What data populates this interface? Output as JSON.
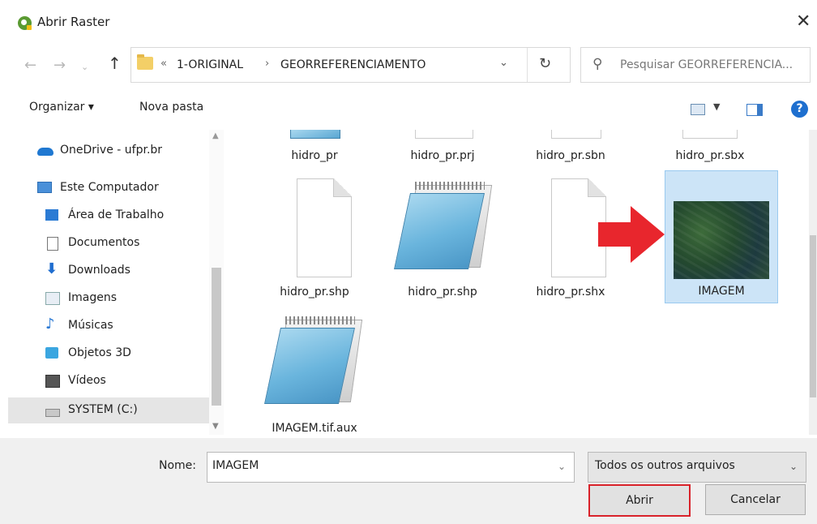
{
  "window": {
    "title": "Abrir Raster",
    "close_glyph": "✕"
  },
  "nav": {
    "back_icon": "←",
    "forward_icon": "→",
    "up_icon": "↑",
    "breadcrumb_prefix": "«",
    "breadcrumb": [
      "1-ORIGINAL",
      "GEORREFERENCIAMENTO"
    ],
    "breadcrumb_sep": "›",
    "dropdown_glyph": "⌄",
    "refresh_glyph": "↻",
    "search_placeholder": "Pesquisar GEORREFERENCIA...",
    "search_glyph": "⚲"
  },
  "toolbar": {
    "organize": "Organizar ▾",
    "new_folder": "Nova pasta",
    "help_glyph": "?"
  },
  "sidebar": {
    "items": [
      {
        "label": "OneDrive - ufpr.br",
        "icon": "onedrive-icon"
      },
      {
        "label": "Este Computador",
        "icon": "computer-icon"
      },
      {
        "label": "Área de Trabalho",
        "icon": "desktop-icon"
      },
      {
        "label": "Documentos",
        "icon": "documents-icon"
      },
      {
        "label": "Downloads",
        "icon": "downloads-icon"
      },
      {
        "label": "Imagens",
        "icon": "pictures-icon"
      },
      {
        "label": "Músicas",
        "icon": "music-icon"
      },
      {
        "label": "Objetos 3D",
        "icon": "objects-3d-icon"
      },
      {
        "label": "Vídeos",
        "icon": "videos-icon"
      },
      {
        "label": "SYSTEM (C:)",
        "icon": "drive-icon"
      }
    ],
    "selected_index": 9
  },
  "files": [
    {
      "name": "hidro_pr",
      "icon": "notepad-icon"
    },
    {
      "name": "hidro_pr.prj",
      "icon": "blank-document-icon"
    },
    {
      "name": "hidro_pr.sbn",
      "icon": "blank-document-icon"
    },
    {
      "name": "hidro_pr.sbx",
      "icon": "blank-document-icon"
    },
    {
      "name": "hidro_pr.shp",
      "icon": "blank-document-icon"
    },
    {
      "name": "hidro_pr.shp",
      "icon": "notepad-icon"
    },
    {
      "name": "hidro_pr.shx",
      "icon": "blank-document-icon"
    },
    {
      "name": "IMAGEM",
      "icon": "raster-image-thumbnail",
      "selected": true
    },
    {
      "name": "IMAGEM.tif.aux",
      "icon": "notepad-icon"
    }
  ],
  "footer": {
    "name_label": "Nome:",
    "name_value": "IMAGEM",
    "type_value": "Todos os outros arquivos",
    "open_button": "Abrir",
    "cancel_button": "Cancelar",
    "dropdown_glyph": "⌄"
  },
  "colors": {
    "highlight_arrow": "#e8262d",
    "selection": "#cce4f7",
    "open_button_outline": "#d9222a"
  }
}
